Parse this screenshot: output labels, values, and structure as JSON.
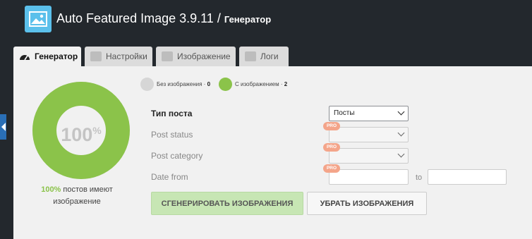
{
  "header": {
    "title": "Auto Featured Image 3.9.11",
    "separator": "/",
    "subtitle": "Генератор",
    "logo_icon": "image-icon"
  },
  "tabs": [
    {
      "label": "Генератор",
      "icon": "dashboard-icon",
      "active": true
    },
    {
      "label": "Настройки",
      "icon": "settings-icon",
      "active": false
    },
    {
      "label": "Изображение",
      "icon": "picture-icon",
      "active": false
    },
    {
      "label": "Логи",
      "icon": "list-icon",
      "active": false
    }
  ],
  "legend": {
    "without": {
      "label": "Без изображения",
      "sep": "·",
      "count": "0",
      "color": "#d6d6d6"
    },
    "with": {
      "label": "С изображением",
      "sep": "·",
      "count": "2",
      "color": "#8bc34a"
    }
  },
  "donut": {
    "percent_value": "100",
    "percent_sign": "%",
    "fraction_with_image": 1.0,
    "caption_highlight": "100%",
    "caption_rest": "постов имеют изображение",
    "ring_color": "#8bc34a"
  },
  "form": {
    "post_type": {
      "label": "Тип поста",
      "value": "Посты"
    },
    "post_status": {
      "label": "Post status",
      "value": "",
      "badge": "PRO"
    },
    "post_category": {
      "label": "Post category",
      "value": "",
      "badge": "PRO"
    },
    "date_from": {
      "label": "Date from",
      "value": "",
      "badge": "PRO",
      "to_label": "to",
      "to_value": ""
    }
  },
  "buttons": {
    "generate": "СГЕНЕРИРОВАТЬ ИЗОБРАЖЕНИЯ",
    "remove": "УБРАТЬ ИЗОБРАЖЕНИЯ"
  }
}
